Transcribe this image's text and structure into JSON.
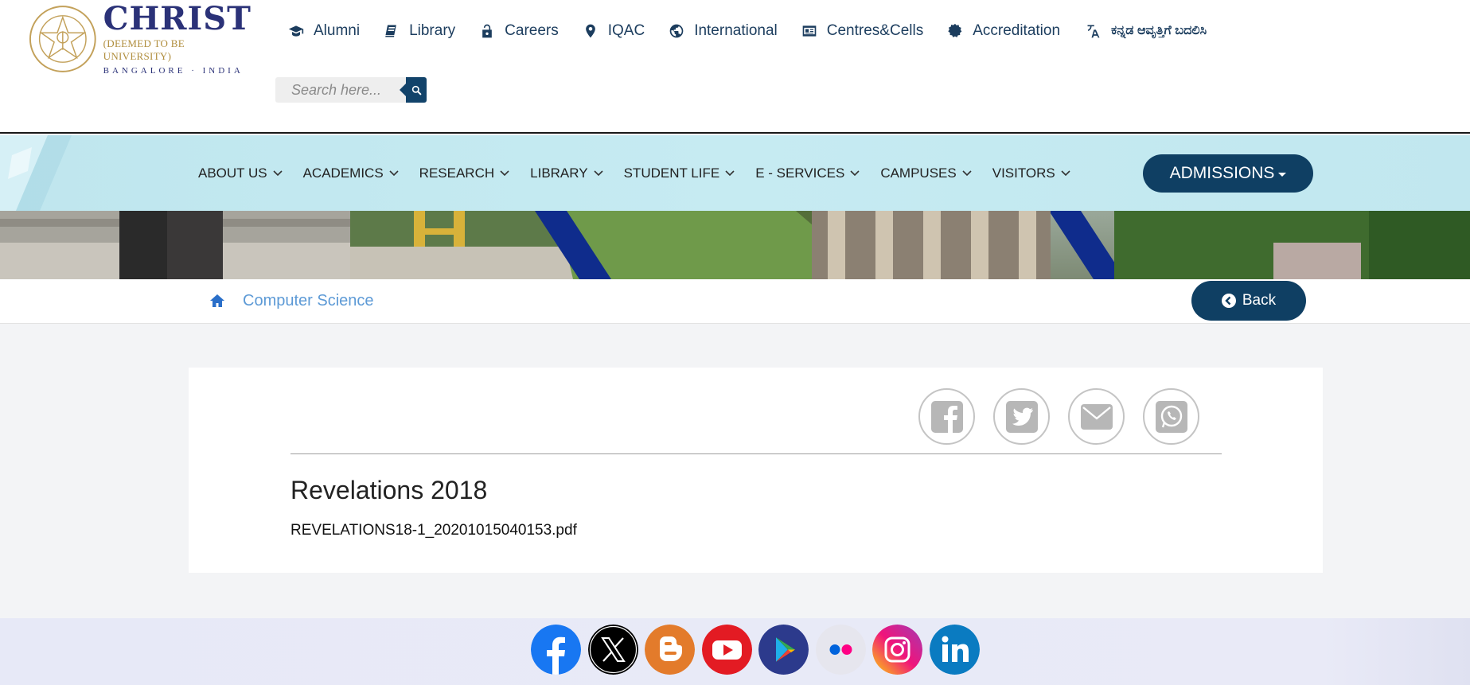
{
  "header": {
    "logo": {
      "name": "CHRIST",
      "subtitle": "(DEEMED TO BE UNIVERSITY)",
      "location": "BANGALORE · INDIA"
    },
    "quick_links": [
      {
        "label": "Alumni",
        "icon": "graduation-cap-icon"
      },
      {
        "label": "Library",
        "icon": "book-icon"
      },
      {
        "label": "Careers",
        "icon": "unlock-icon"
      },
      {
        "label": "IQAC",
        "icon": "map-marker-icon"
      },
      {
        "label": "International",
        "icon": "globe-icon"
      },
      {
        "label": "Centres&Cells",
        "icon": "id-card-icon"
      },
      {
        "label": "Accreditation",
        "icon": "certificate-icon"
      }
    ],
    "language_switch": "ಕನ್ನಡ ಆವೃತ್ತಿಗೆ ಬದಲಿಸಿ",
    "search": {
      "placeholder": "Search here...",
      "value": ""
    }
  },
  "nav": {
    "items": [
      {
        "label": "ABOUT US"
      },
      {
        "label": "ACADEMICS"
      },
      {
        "label": "RESEARCH"
      },
      {
        "label": "LIBRARY"
      },
      {
        "label": "STUDENT LIFE"
      },
      {
        "label": "E - SERVICES"
      },
      {
        "label": "CAMPUSES"
      },
      {
        "label": "VISITORS"
      }
    ],
    "admissions_label": "ADMISSIONS"
  },
  "breadcrumb": {
    "current": "Computer Science",
    "back_label": "Back"
  },
  "content": {
    "share": [
      "facebook-icon",
      "twitter-icon",
      "mail-icon",
      "whatsapp-icon"
    ],
    "title": "Revelations 2018",
    "file": "REVELATIONS18-1_20201015040153.pdf"
  },
  "footer": {
    "socials": [
      "facebook-icon",
      "x-icon",
      "blogger-icon",
      "youtube-icon",
      "play-store-icon",
      "flickr-icon",
      "instagram-icon",
      "linkedin-icon"
    ]
  },
  "colors": {
    "primary": "#0f3f63",
    "link": "#5d9ad6",
    "nav_bg": "#c6ebf2",
    "brand_blue": "#2b3278",
    "brand_gold": "#b08d3c"
  }
}
